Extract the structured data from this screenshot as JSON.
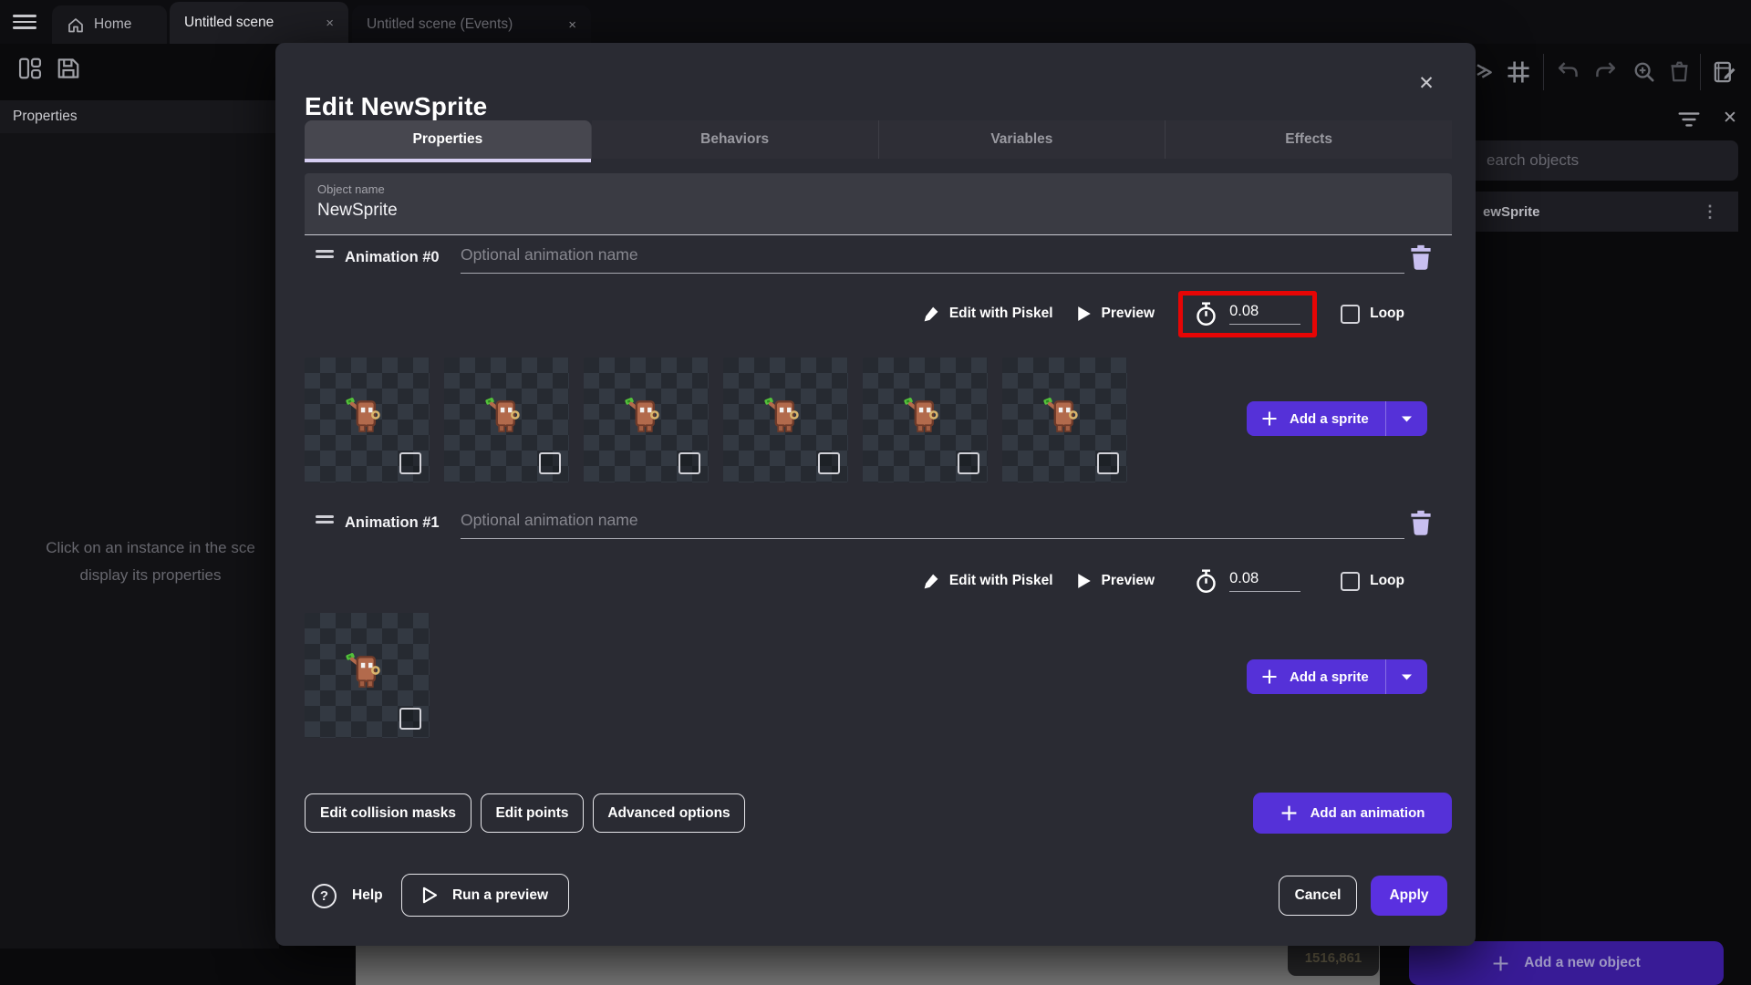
{
  "window": {
    "hamburger_icon": "menu-icon",
    "tabs": [
      {
        "label": "Home"
      },
      {
        "label": "Untitled scene",
        "close": "×",
        "active": true
      },
      {
        "label": "Untitled scene (Events)",
        "close": "×",
        "active": false
      }
    ]
  },
  "left_panel": {
    "title": "Properties",
    "empty_line1": "Click on an instance in the sce",
    "empty_line2": "display its properties"
  },
  "right_panel": {
    "search_placeholder": "earch objects",
    "object_item": "ewSprite",
    "kebab_icon": "⋮",
    "add_object_label": "Add a new object"
  },
  "scene": {
    "coords_badge": "1516,861"
  },
  "dialog": {
    "title": "Edit NewSprite",
    "close_icon": "✕",
    "tabs": [
      "Properties",
      "Behaviors",
      "Variables",
      "Effects"
    ],
    "active_tab": "Properties",
    "object_name": {
      "label": "Object name",
      "value": "NewSprite"
    },
    "animations": [
      {
        "name_label": "Animation #0",
        "name_placeholder": "Optional animation name",
        "edit_piskel_label": "Edit with Piskel",
        "preview_label": "Preview",
        "time_value": "0.08",
        "time_highlighted": true,
        "loop_label": "Loop",
        "frames": 6,
        "add_sprite_label": "Add a sprite"
      },
      {
        "name_label": "Animation #1",
        "name_placeholder": "Optional animation name",
        "edit_piskel_label": "Edit with Piskel",
        "preview_label": "Preview",
        "time_value": "0.08",
        "time_highlighted": false,
        "loop_label": "Loop",
        "frames": 1,
        "add_sprite_label": "Add a sprite"
      }
    ],
    "footer_buttons": [
      "Edit collision masks",
      "Edit points",
      "Advanced options"
    ],
    "add_animation_label": "Add an animation",
    "help_label": "Help",
    "run_preview_label": "Run a preview",
    "cancel_label": "Cancel",
    "apply_label": "Apply"
  },
  "colors": {
    "accent_purple": "#5531d8",
    "apply_purple": "#5a30e0",
    "highlight_red": "#e60505",
    "lavender_icon": "#c8bff0",
    "tab_underline": "#d6cef2"
  }
}
